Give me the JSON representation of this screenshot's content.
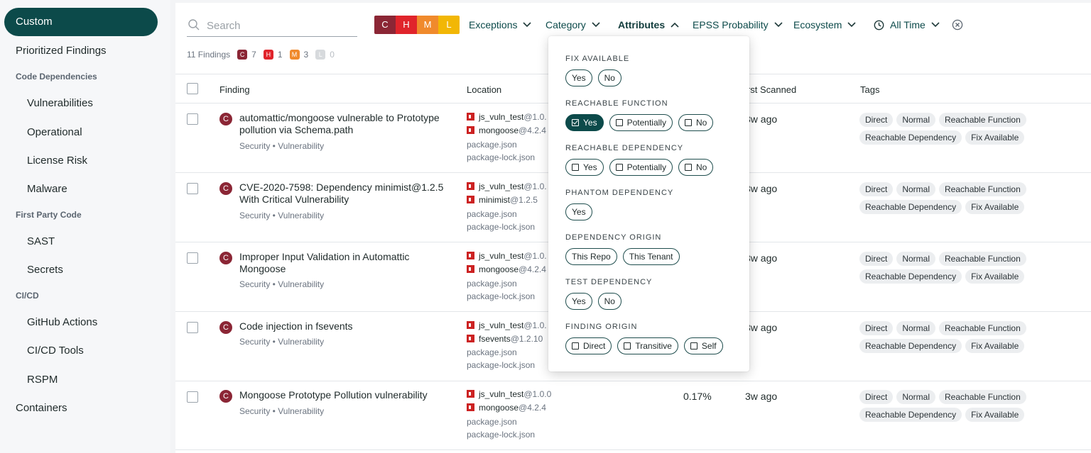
{
  "sidebar": {
    "active": "Custom",
    "items": [
      {
        "label": "Prioritized Findings"
      },
      {
        "section": "Code Dependencies"
      },
      {
        "label": "Vulnerabilities"
      },
      {
        "label": "Operational"
      },
      {
        "label": "License Risk"
      },
      {
        "label": "Malware"
      },
      {
        "section": "First Party Code"
      },
      {
        "label": "SAST"
      },
      {
        "label": "Secrets"
      },
      {
        "section": "CI/CD"
      },
      {
        "label": "GitHub Actions"
      },
      {
        "label": "CI/CD Tools"
      },
      {
        "label": "RSPM"
      },
      {
        "label": "Containers"
      }
    ]
  },
  "toolbar": {
    "search_placeholder": "Search",
    "severity_buttons": [
      {
        "label": "C",
        "color": "#8b2635"
      },
      {
        "label": "H",
        "color": "#e0242b"
      },
      {
        "label": "M",
        "color": "#f08a2c"
      },
      {
        "label": "L",
        "color": "#f2b705"
      }
    ],
    "filters": [
      "Exceptions",
      "Category",
      "Attributes",
      "EPSS Probability",
      "Ecosystem",
      "All Time"
    ],
    "active_filter": "Attributes"
  },
  "summary": {
    "findings_label": "11 Findings",
    "counts": [
      {
        "label": "C",
        "count": "7",
        "color": "#8b2635"
      },
      {
        "label": "H",
        "count": "1",
        "color": "#e0242b"
      },
      {
        "label": "M",
        "count": "3",
        "color": "#f08a2c"
      },
      {
        "label": "L",
        "count": "0",
        "color": "#d7dadd"
      }
    ]
  },
  "table": {
    "columns": {
      "finding": "Finding",
      "location": "Location",
      "first_scanned": "First Scanned",
      "first_scanned_visible": "irst Scanned",
      "tags": "Tags"
    },
    "rows": [
      {
        "severity": "C",
        "title": "automattic/mongoose vulnerable to Prototype pollution via Schema.path",
        "meta": "Security  •  Vulnerability",
        "loc1_name": "js_vuln_test",
        "loc1_ver": "@1.0.",
        "loc2_name": "mongoose",
        "loc2_ver": "@4.2.4",
        "file1": "package.json",
        "file2": "package-lock.json",
        "epss": "",
        "scanned": "3w ago",
        "tags": [
          "Direct",
          "Normal",
          "Reachable Function",
          "Reachable Dependency",
          "Fix Available"
        ]
      },
      {
        "severity": "C",
        "title": "CVE-2020-7598: Dependency minimist@1.2.5 With Critical Vulnerability",
        "meta": "Security  •  Vulnerability",
        "loc1_name": "js_vuln_test",
        "loc1_ver": "@1.0.",
        "loc2_name": "minimist",
        "loc2_ver": "@1.2.5",
        "file1": "package.json",
        "file2": "package-lock.json",
        "epss": "",
        "scanned": "3w ago",
        "tags": [
          "Direct",
          "Normal",
          "Reachable Function",
          "Reachable Dependency",
          "Fix Available"
        ]
      },
      {
        "severity": "C",
        "title": "Improper Input Validation in Automattic Mongoose",
        "meta": "Security  •  Vulnerability",
        "loc1_name": "js_vuln_test",
        "loc1_ver": "@1.0.",
        "loc2_name": "mongoose",
        "loc2_ver": "@4.2.4",
        "file1": "package.json",
        "file2": "package-lock.json",
        "epss": "",
        "scanned": "3w ago",
        "tags": [
          "Direct",
          "Normal",
          "Reachable Function",
          "Reachable Dependency",
          "Fix Available"
        ]
      },
      {
        "severity": "C",
        "title": "Code injection in fsevents",
        "meta": "Security  •  Vulnerability",
        "loc1_name": "js_vuln_test",
        "loc1_ver": "@1.0.",
        "loc2_name": "fsevents",
        "loc2_ver": "@1.2.10",
        "file1": "package.json",
        "file2": "package-lock.json",
        "epss": "",
        "scanned": "3w ago",
        "tags": [
          "Direct",
          "Normal",
          "Reachable Function",
          "Reachable Dependency",
          "Fix Available"
        ]
      },
      {
        "severity": "C",
        "title": "Mongoose Prototype Pollution vulnerability",
        "meta": "Security  •  Vulnerability",
        "loc1_name": "js_vuln_test",
        "loc1_ver": "@1.0.0",
        "loc2_name": "mongoose",
        "loc2_ver": "@4.2.4",
        "file1": "package.json",
        "file2": "package-lock.json",
        "epss": "0.17%",
        "scanned": "3w ago",
        "tags": [
          "Direct",
          "Normal",
          "Reachable Function",
          "Reachable Dependency",
          "Fix Available"
        ]
      }
    ]
  },
  "attributes_dropdown": {
    "sections": [
      {
        "title": "FIX AVAILABLE",
        "options": [
          {
            "label": "Yes",
            "box": false
          },
          {
            "label": "No",
            "box": false
          }
        ]
      },
      {
        "title": "REACHABLE FUNCTION",
        "options": [
          {
            "label": "Yes",
            "box": true,
            "selected": true
          },
          {
            "label": "Potentially",
            "box": true
          },
          {
            "label": "No",
            "box": true
          }
        ]
      },
      {
        "title": "REACHABLE DEPENDENCY",
        "options": [
          {
            "label": "Yes",
            "box": true
          },
          {
            "label": "Potentially",
            "box": true
          },
          {
            "label": "No",
            "box": true
          }
        ]
      },
      {
        "title": "PHANTOM DEPENDENCY",
        "options": [
          {
            "label": "Yes",
            "box": false
          }
        ]
      },
      {
        "title": "DEPENDENCY ORIGIN",
        "options": [
          {
            "label": "This Repo",
            "box": false
          },
          {
            "label": "This Tenant",
            "box": false
          }
        ]
      },
      {
        "title": "TEST DEPENDENCY",
        "options": [
          {
            "label": "Yes",
            "box": false
          },
          {
            "label": "No",
            "box": false
          }
        ]
      },
      {
        "title": "FINDING ORIGIN",
        "options": [
          {
            "label": "Direct",
            "box": true
          },
          {
            "label": "Transitive",
            "box": true
          },
          {
            "label": "Self",
            "box": true
          }
        ]
      }
    ]
  }
}
